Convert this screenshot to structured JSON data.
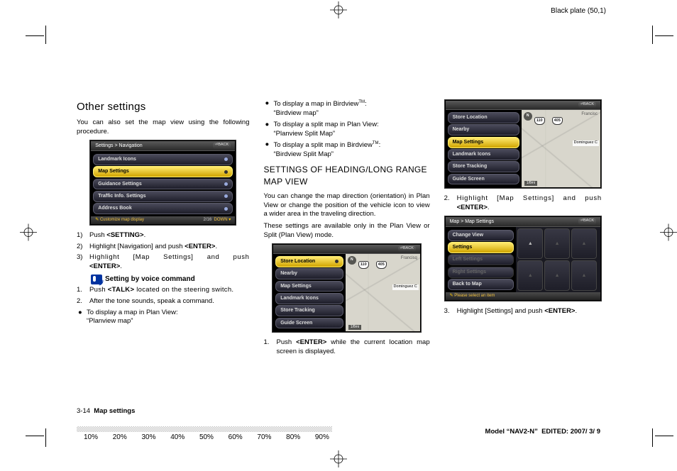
{
  "meta": {
    "plate_label": "Black plate (50,1)"
  },
  "col1": {
    "title": "Other settings",
    "intro": "You can also set the map view using the following procedure.",
    "screenshot1": {
      "header_left": "Settings > Navigation",
      "header_right": "BACK",
      "items": [
        "Landmark Icons",
        "Map Settings",
        "Guidance Settings",
        "Traffic Info. Settings",
        "Address Book"
      ],
      "highlighted_index": 1,
      "footer_left": "Customize map display",
      "footer_right_pager": "2/16",
      "footer_right_down": "DOWN"
    },
    "steps": [
      {
        "num": "1)",
        "text_pre": "Push ",
        "bold": "<SETTING>",
        "text_post": "."
      },
      {
        "num": "2)",
        "text_pre": "Highlight [Navigation] and push ",
        "bold": "<ENTER>",
        "text_post": "."
      },
      {
        "num": "3)",
        "text_pre": "Highlight [Map Settings] and push ",
        "bold": "<ENTER>",
        "text_post": ".",
        "wide": true
      }
    ],
    "voice_heading": "Setting by voice command",
    "voice_steps": [
      {
        "num": "1.",
        "text_pre": "Push ",
        "bold": "<TALK>",
        "text_post": " located on the steering switch.",
        "wide": true
      },
      {
        "num": "2.",
        "text_pre": "After the tone sounds, speak a command.",
        "bold": "",
        "text_post": ""
      }
    ],
    "voice_bullets": [
      {
        "line1": "To display a map in Plan View:",
        "line2": "“Planview map”"
      }
    ]
  },
  "col2": {
    "top_bullets": [
      {
        "line1_pre": "To display a map in Birdview",
        "line1_sup": "TM",
        "line1_post": ":",
        "line2": "“Birdview map”"
      },
      {
        "line1_pre": "To display a split map in Plan View:",
        "line1_sup": "",
        "line1_post": "",
        "line2": "“Planview Split Map”"
      },
      {
        "line1_pre": "To display a split map in Birdview",
        "line1_sup": "TM",
        "line1_post": ":",
        "line2": "“Birdview Split Map”"
      }
    ],
    "title": "SETTINGS OF HEADING/LONG RANGE MAP VIEW",
    "para1": "You can change the map direction (orientation) in Plan View or change the position of the vehicle icon to view a wider area in the traveling direction.",
    "para2": "These settings are available only in the Plan View or Split (Plan View) mode.",
    "screenshot2": {
      "header_left": "",
      "header_right": "BACK",
      "items": [
        "Store Location",
        "Nearby",
        "Map Settings",
        "Landmark Icons",
        "Store Tracking",
        "Guide Screen"
      ],
      "map_shields": [
        "110",
        "405"
      ],
      "map_city_top": "Francisq",
      "map_dest": "Dominguez C",
      "map_scale": "1/8mi"
    },
    "step1": {
      "num": "1.",
      "text_pre": "Push ",
      "bold": "<ENTER>",
      "text_post": " while the current location map screen is displayed.",
      "wide": true
    }
  },
  "col3": {
    "screenshot3": {
      "header_left": "",
      "header_right": "BACK",
      "items": [
        "Store Location",
        "Nearby",
        "Map Settings",
        "Landmark Icons",
        "Store Tracking",
        "Guide Screen"
      ],
      "highlighted_index": 2,
      "map_shields": [
        "110",
        "405"
      ],
      "map_city_top": "Francisc",
      "map_dest": "Dominguez C",
      "map_scale": "1/8mi"
    },
    "step2": {
      "num": "2.",
      "text_pre": "Highlight [Map Settings] and push ",
      "bold": "<ENTER>",
      "text_post": ".",
      "wide": true
    },
    "screenshot4": {
      "header_left": "Map > Map Settings",
      "header_right": "BACK",
      "items": [
        "Change View",
        "Settings",
        "Left Settings",
        "Right Settings",
        "Back to Map"
      ],
      "highlighted_index": 1,
      "dim_indices": [
        2,
        3
      ],
      "footer_left": "Please select an item"
    },
    "step3": {
      "num": "3.",
      "text_pre": "Highlight [Settings] and push ",
      "bold": "<ENTER>",
      "text_post": "."
    }
  },
  "footer": {
    "page_num": "3-14",
    "section": "Map settings",
    "model_pre": "Model “",
    "model_bold": "NAV2-N",
    "model_post": "”",
    "edited": "EDITED: 2007/ 3/ 9",
    "percentages": [
      "10%",
      "20%",
      "30%",
      "40%",
      "50%",
      "60%",
      "70%",
      "80%",
      "90%"
    ]
  }
}
